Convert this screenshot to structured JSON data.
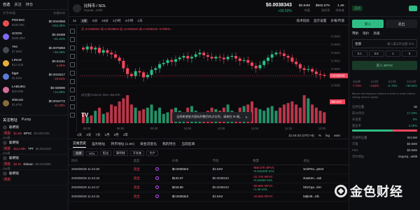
{
  "left": {
    "tabs": [
      "自选",
      "关注",
      "持仓"
    ],
    "columns": [
      "代币/市值",
      "价格/24h"
    ],
    "tokens": [
      {
        "name": "PEKING",
        "sub": "$435.55K",
        "price": "$0.0042958",
        "chg": "+245.38%",
        "color": "#e84f4f"
      },
      {
        "name": "SOON",
        "sub": "$189.99M",
        "price": "$0.39469",
        "chg": "+11.41%",
        "color": "#7c6cf2"
      },
      {
        "name": "Yes",
        "sub": "$7.69M",
        "price": "$0.0076893",
        "chg": "+46.29%",
        "color": "#444a52"
      },
      {
        "name": "LINUX",
        "sub": "$12.41M",
        "price": "$0.01241",
        "chg": "-4.45%",
        "color": "#e6b13a"
      },
      {
        "name": "bgpt",
        "sub": "$1.92M",
        "price": "$0.0019217",
        "chg": "-19.54%",
        "color": "#5b7bd5"
      },
      {
        "name": "LABUBU",
        "sub": "$28.69M",
        "price": "$0.028690",
        "chg": "+12.89%",
        "color": "#d66e9b"
      },
      {
        "name": "shitcoin",
        "sub": "$1.67M",
        "price": "$0.0016772",
        "chg": "-11.03%",
        "color": "#8a6a3a"
      }
    ],
    "signals_tabs": [
      "关注地址",
      "Pump"
    ],
    "signals": [
      {
        "who": "聪明钱",
        "side": "卖出",
        "amount": "$1.4M",
        "token": "BPVC",
        "price": "$0.0037208",
        "time": "42s前"
      },
      {
        "who": "聪明钱",
        "side": "卖出",
        "amount": "$114.68K",
        "token": "TPT",
        "price": "$0.0022254",
        "time": "43s前"
      },
      {
        "who": "聪明钱",
        "side": "卖出",
        "amount": "$2.4K",
        "token": "shitcoin",
        "price": "$0.0016895",
        "time": "43s前"
      },
      {
        "who": "聪明钱",
        "side": "卖出",
        "amount": "",
        "token": "",
        "price": "",
        "time": ""
      }
    ]
  },
  "header": {
    "title": "比特币 / SOL",
    "subtitle": "Ergu4p...uMi8",
    "price": "$0.0038343",
    "change": "+30.52%",
    "stats": [
      {
        "label": "市值",
        "value": "$3.84M"
      },
      {
        "label": "流动性",
        "value": "$582.57K"
      },
      {
        "label": "持有者",
        "value": "1.4K"
      }
    ]
  },
  "toolbar": {
    "items": [
      "1s",
      "1分",
      "5分",
      "15分",
      "1小时",
      "4小时",
      "1天",
      "技术指标",
      "显示设置",
      "价格/市值"
    ],
    "active": "1分"
  },
  "chart_data": {
    "type": "candlestick",
    "title": "",
    "ohlc_label": "开=0.0038002 高=0.0038602 低=0.0038343 收=0.0038343 -0.00000...",
    "volume_label": "成交量(Volume) SMA 455.57K",
    "x_ticks": [
      "08:30",
      "09:00",
      "09:30",
      "10:00",
      "10:30",
      "11:00",
      "11:30",
      "12:00"
    ],
    "y_ticks": [
      "0.0048",
      "0.0046",
      "0.0044",
      "0.0042",
      "0.0040",
      "0.0038",
      "0.0036"
    ],
    "ylim": [
      0.0035,
      0.0049
    ],
    "closes": [
      0.00448,
      0.00455,
      0.00448,
      0.00452,
      0.0044,
      0.00446,
      0.0044,
      0.00436,
      0.00428,
      0.0042,
      0.00402,
      0.00388,
      0.00383,
      0.00395,
      0.00392,
      0.0038,
      0.00386,
      0.00398,
      0.00402,
      0.00412,
      0.00415,
      0.00422,
      0.00418,
      0.00424,
      0.00428,
      0.00432,
      0.00426,
      0.0043,
      0.00436,
      0.0044,
      0.00434,
      0.0043,
      0.00426,
      0.0043,
      0.00428,
      0.00424,
      0.0043,
      0.00432,
      0.00426,
      0.0042,
      0.00422,
      0.00416,
      0.00408,
      0.00402,
      0.0041,
      0.0042,
      0.00428,
      0.00436,
      0.0044,
      0.00438,
      0.00432,
      0.00428,
      0.00418,
      0.00412,
      0.00402,
      0.00398,
      0.004,
      0.00394,
      0.00388,
      0.00386,
      0.00384
    ],
    "volumes": [
      0.3,
      0.2,
      0.25,
      0.4,
      0.5,
      0.3,
      0.35,
      0.6,
      0.55,
      0.7,
      0.8,
      0.9,
      0.6,
      0.5,
      0.4,
      0.45,
      0.5,
      0.6,
      0.4,
      0.5,
      0.3,
      0.35,
      0.45,
      0.5,
      0.4,
      0.3,
      0.5,
      0.55,
      0.4,
      0.35,
      0.3,
      0.4,
      0.5,
      0.45,
      0.4,
      0.5,
      0.6,
      0.4,
      0.35,
      0.5,
      0.55,
      0.6,
      0.7,
      0.5,
      0.45,
      0.4,
      0.5,
      0.55,
      0.4,
      0.5,
      0.6,
      0.65,
      0.7,
      0.6,
      0.5,
      0.9,
      0.8,
      0.6,
      0.5,
      0.4,
      0.35
    ],
    "last_price_label": "0.0038343",
    "last_volume_label": "455.57K"
  },
  "toast": {
    "text": "当您希望放大图标到整页的点位时，请按住 W 键。"
  },
  "range": {
    "items": [
      "1天",
      "3天",
      "7天",
      "1月",
      "3月",
      "1年"
    ],
    "time": "11:44:42 (UTC+8)",
    "pct": "%",
    "log": "log",
    "auto": "auto"
  },
  "trades": {
    "tabs": [
      "交易历史",
      "盈利地址",
      "持币地址 (1.6K)",
      "资金流变化",
      "我的持仓",
      "当前挂单"
    ],
    "filters": [
      "全部",
      "KOL",
      "狙击",
      "聪明钱",
      "开发者",
      "大户"
    ],
    "columns": [
      "时间",
      "类型",
      "",
      "价格",
      "市值",
      "数量",
      "地址"
    ],
    "rows": [
      {
        "time": "2025/06/26 11:44:28",
        "type": "卖出",
        "usd": "$0.0038343",
        "mc": "$3.84M",
        "qty": "-856.57K BPVC",
        "sol": "+6.645489 SOL",
        "addr": "5AhP4s...pmr2"
      },
      {
        "time": "2025/06/26 11:44:18",
        "type": "卖出",
        "usd": "$122.07",
        "mc": "$0.0038343",
        "qty": "-31.74K BPVC",
        "sol": "+0.84569 SOL",
        "addr": "EasK2n...sok"
      },
      {
        "time": "2025/06/26 11:44:17",
        "type": "卖出",
        "usd": "$218.80",
        "mc": "$0.0038343",
        "qty": "-56.96K BPVC",
        "sol": "+1.38 SOL",
        "addr": "bh2Cqa...kiH"
      },
      {
        "time": "2025/06/26 11:44:15",
        "type": "卖出",
        "usd": "$0.0038343",
        "mc": "$3.84M",
        "qty": "-16.55K BPVC",
        "sol": "",
        "addr": "k6jh49...nfs"
      }
    ]
  },
  "right": {
    "badge": "自动",
    "tabs": [
      "买入",
      "卖出"
    ],
    "order_tabs": [
      "市价",
      "限价",
      "高级"
    ],
    "amount_label": "金额",
    "amount_placeholder": "输入要买的金额 SOL",
    "presets": [
      "0.1",
      "0.5",
      "1",
      "5"
    ],
    "buy_label": "买入 BPVC",
    "perf": [
      {
        "label": "5分钟",
        "value": "-7.74%"
      },
      {
        "label": "1小时",
        "value": "-4.62%"
      },
      {
        "label": "6小时",
        "value": "+1.76%"
      },
      {
        "label": "24小时",
        "value": "+30.52%"
      }
    ],
    "note": "Bitcoin will empower builders to build on scale without raising venture capital.",
    "kv": [
      {
        "k": "总供应量",
        "v": "1B"
      },
      {
        "k": "前10持仓",
        "v": "17.33%"
      },
      {
        "k": "开发者",
        "v": "0%"
      },
      {
        "k": "狙击手",
        "v": "3.29%"
      }
    ],
    "meta": [
      {
        "k": "流通供应量",
        "v": "924.6M"
      },
      {
        "k": "市值",
        "v": "$3.84M"
      },
      {
        "k": "FDV",
        "v": "$3.84M"
      },
      {
        "k": "合约地址",
        "v": "Ergu4p...uMi8"
      }
    ],
    "holder_ratio": 0.62
  },
  "watermark": {
    "text": "金色财经"
  }
}
